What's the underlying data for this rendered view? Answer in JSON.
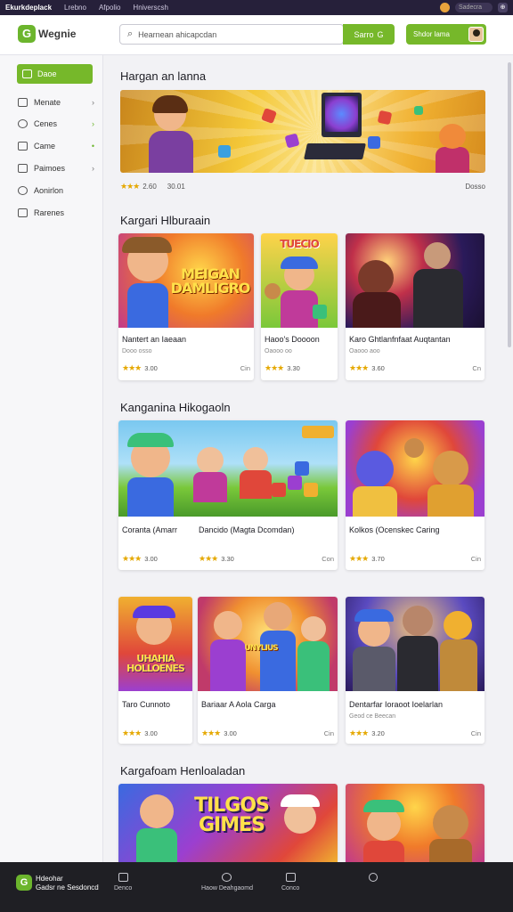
{
  "topbar": {
    "brand": "Ekurkdeplack",
    "links": [
      "Lrebno",
      "Afpolio",
      "Hniverscsh"
    ],
    "search_placeholder": "Sadecra",
    "icon_label": "⊕"
  },
  "header": {
    "logo_text": "Wegnie",
    "search_placeholder": "Hearnean ahicapcdan",
    "search_button": "Sarro",
    "signin_label": "Shdor lama"
  },
  "sidebar": {
    "active_label": "Daoe",
    "items": [
      {
        "label": "Menate",
        "icon": "monitor-icon"
      },
      {
        "label": "Cenes",
        "icon": "users-icon"
      },
      {
        "label": "Came",
        "icon": "gamepad-icon"
      },
      {
        "label": "Paimoes",
        "icon": "folder-icon"
      },
      {
        "label": "Aonirlon",
        "icon": "gear-icon"
      },
      {
        "label": "Rarenes",
        "icon": "calendar-icon"
      }
    ]
  },
  "sections": [
    {
      "title": "Hargan an lanna"
    },
    {
      "title": "Kargari Hlburaain"
    },
    {
      "title": "Kanganina Hikogaoln"
    },
    {
      "title": "Kargafoam Henloaladan"
    }
  ],
  "banner": {
    "rating": "2.60",
    "duration": "30.01",
    "tag": "Dosso"
  },
  "cards_row1": [
    {
      "thumb_text": "MEIGAN DAMLIGRO",
      "title": "Nantert an Iaeaan",
      "sub": "Dooo osso",
      "rating": "3.00",
      "platform": "Cin"
    },
    {
      "thumb_text": "TUECIO",
      "title": "Haoo's Doooon",
      "sub": "Oaooo oo",
      "rating": "3.30",
      "platform": ""
    },
    {
      "thumb_text": "",
      "title": "Karo Ghtlanfnfaat Auqtantan",
      "sub": "Oaooo aoo",
      "rating": "3.60",
      "platform": "Cn"
    }
  ],
  "cards_row2": [
    {
      "thumb_text": "",
      "title": "Coranta (Amarr",
      "title2": "Dancido (Magta Dcomdan)",
      "rating": "3.00",
      "rating2": "3.30",
      "platform": "Con"
    },
    {
      "thumb_text": "",
      "title": "Kolkos (Ocenskec Caring",
      "rating": "3.70",
      "platform": "Cin"
    }
  ],
  "cards_row3": [
    {
      "thumb_text": "UHAHIA HOLLOENES",
      "title": "Taro Cunnoto",
      "rating": "3.00",
      "platform": ""
    },
    {
      "thumb_text": "UNYLIUS",
      "title": "Bariaar A Aola Carga",
      "rating": "3.00",
      "platform": "Cin"
    },
    {
      "thumb_text": "",
      "title": "Dentarfar Ioraoot Ioelarlan",
      "sub": "Geod ce Beecan",
      "rating": "3.20",
      "platform": "Cin"
    }
  ],
  "cards_row4": [
    {
      "thumb_text": "TILGOS GIMES"
    },
    {
      "thumb_text": ""
    }
  ],
  "bottomnav": {
    "brand_line1": "Hdeohar",
    "brand_line2": "Gadsr ne Sesdoncd",
    "items": [
      "Denco",
      "Haow Deahgaomd",
      "Conco",
      ""
    ]
  },
  "colors": {
    "accent": "#76b82a",
    "topbar": "#26203a",
    "bottomnav": "#1f1f24"
  }
}
